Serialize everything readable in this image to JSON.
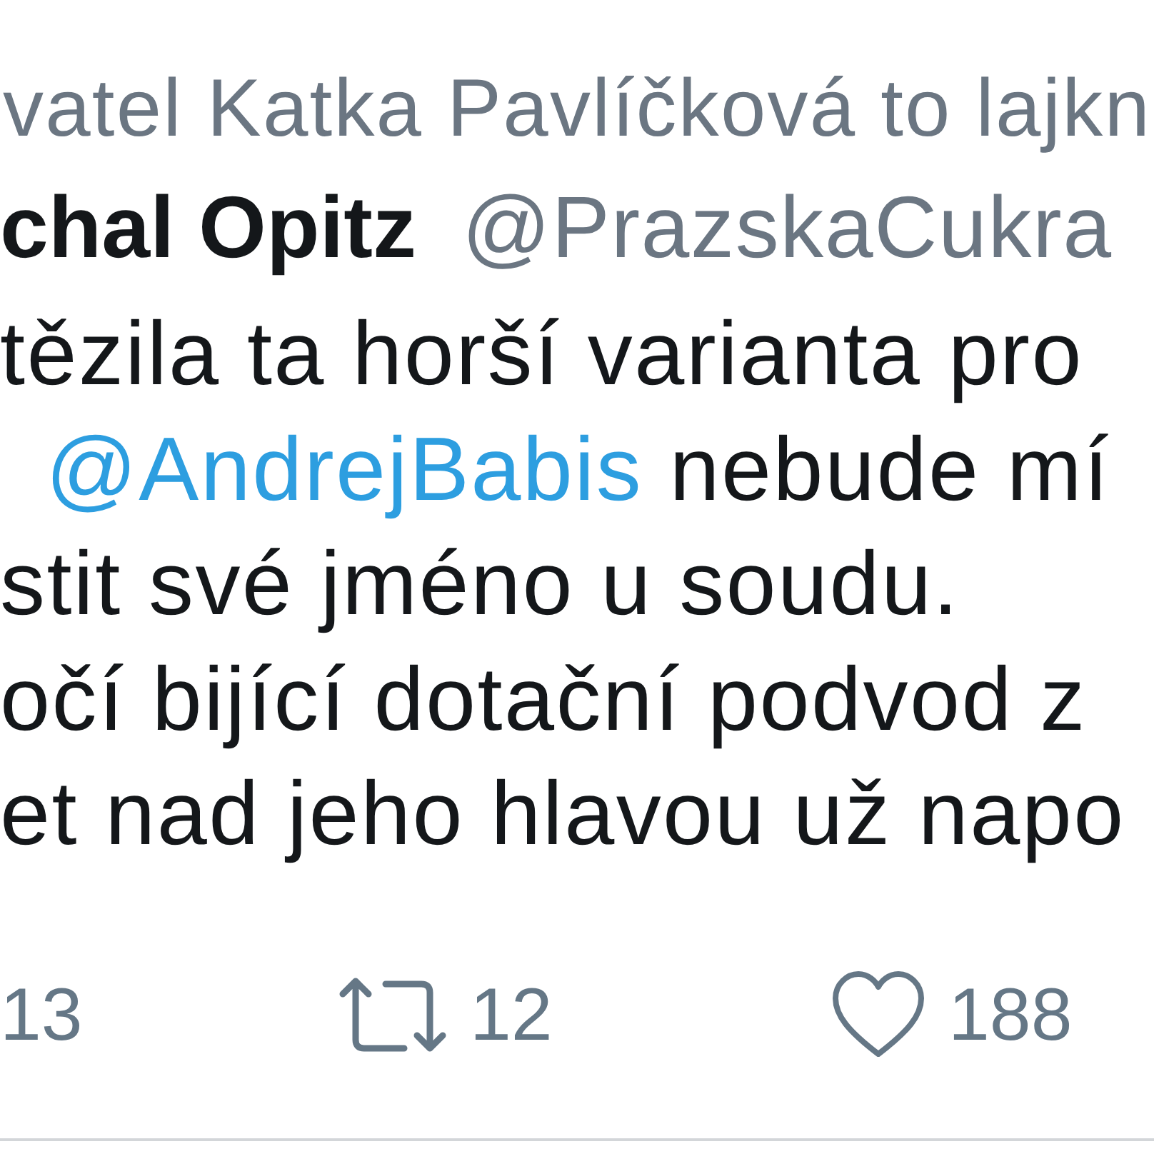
{
  "liked_by": {
    "text": "vatel Katka Pavlíčková to lajkn"
  },
  "tweet": {
    "author_name": "chal Opitz",
    "handle": "@PrazskaCukra",
    "lines": [
      [
        {
          "kind": "text",
          "text": "tězila ta horší varianta pro"
        }
      ],
      [
        {
          "kind": "mention",
          "text": "@AndrejBabis"
        },
        {
          "kind": "text",
          "text": " nebude mí"
        }
      ],
      [
        {
          "kind": "text",
          "text": "stit své jméno u soudu."
        }
      ],
      [
        {
          "kind": "text",
          "text": "očí bijící dotační podvod z"
        }
      ],
      [
        {
          "kind": "text",
          "text": "et nad jeho hlavou už napo"
        }
      ]
    ]
  },
  "actions": [
    {
      "kind": "reply",
      "count": "13"
    },
    {
      "kind": "retweet",
      "count": "12"
    },
    {
      "kind": "like",
      "count": "188"
    }
  ]
}
